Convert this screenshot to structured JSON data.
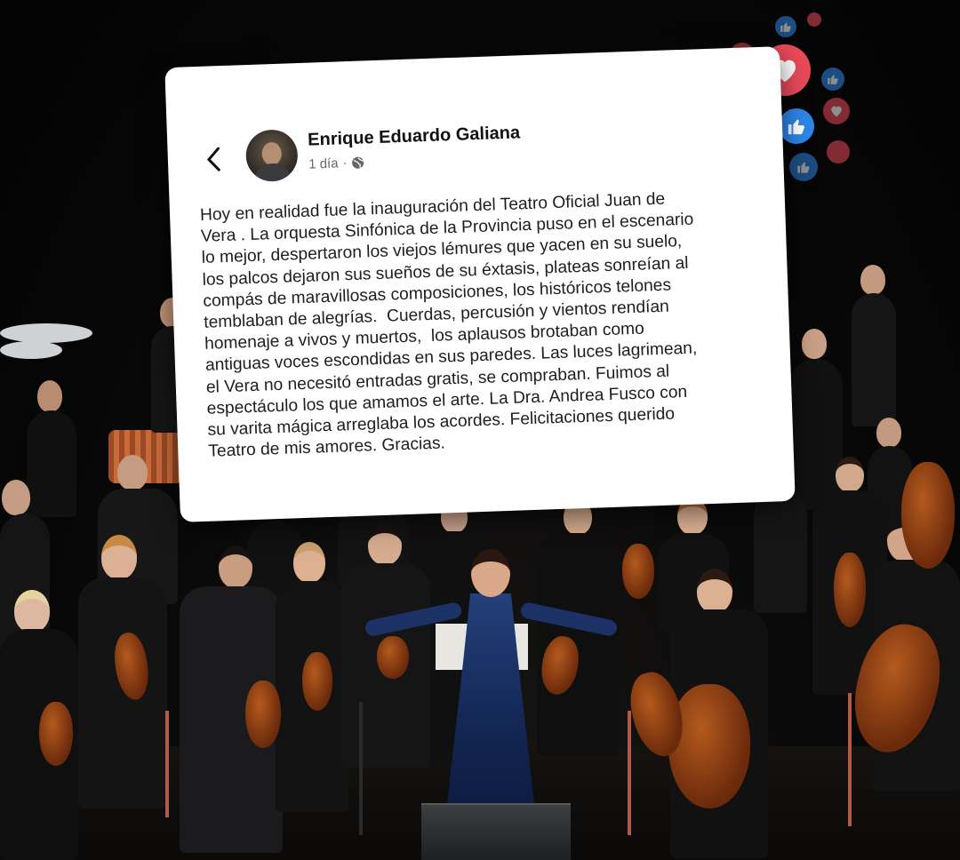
{
  "post": {
    "author": "Enrique Eduardo Galiana",
    "time": "1 día",
    "separator": "·",
    "text_lines": [
      "Hoy en realidad fue la inauguración del Teatro Oficial Juan de",
      "Vera . La orquesta Sinfónica de la Provincia puso en el escenario",
      "lo mejor, despertaron los viejos lémures que yacen en su suelo,",
      "los palcos dejaron sus sueños de su éxtasis, plateas sonreían al",
      "compás de maravillosas composiciones, los históricos telones",
      "temblaban de alegrías.  Cuerdas, percusión y vientos rendían",
      "homenaje a vivos y muertos,  los aplausos brotaban como",
      "antiguas voces escondidas en sus paredes. Las luces lagrimean,",
      "el Vera no necesitó entradas gratis, se compraban. Fuimos al",
      "espectáculo los que amamos el arte. La Dra. Andrea Fusco con",
      "su varita mágica arreglaba los acordes. Felicitaciones querido",
      "Teatro de mis amores. Gracias."
    ]
  },
  "icons": {
    "back": "chevron-left-icon",
    "privacy": "globe-icon",
    "reactions": [
      "like-icon",
      "love-icon"
    ]
  },
  "colors": {
    "like": "#2d86e8",
    "love": "#e94a5a",
    "card": "#ffffff",
    "conductor_dress": "#1a3366"
  }
}
